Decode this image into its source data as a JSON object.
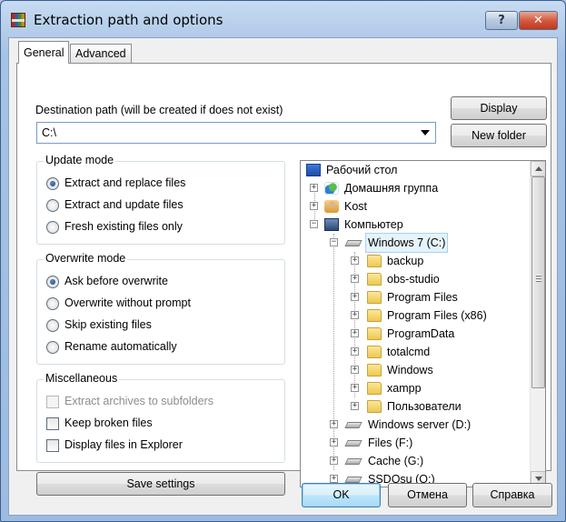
{
  "window": {
    "title": "Extraction path and options",
    "help_label": "?",
    "close_label": "✕"
  },
  "tabs": [
    {
      "label": "General"
    },
    {
      "label": "Advanced"
    }
  ],
  "destination": {
    "label": "Destination path (will be created if does not exist)",
    "value": "C:\\"
  },
  "buttons": {
    "display": "Display",
    "new_folder": "New folder",
    "save_settings": "Save settings",
    "ok": "OK",
    "cancel": "Отмена",
    "help": "Справка"
  },
  "update_mode": {
    "title": "Update mode",
    "options": [
      {
        "label": "Extract and replace files",
        "selected": true
      },
      {
        "label": "Extract and update files",
        "selected": false
      },
      {
        "label": "Fresh existing files only",
        "selected": false
      }
    ]
  },
  "overwrite_mode": {
    "title": "Overwrite mode",
    "options": [
      {
        "label": "Ask before overwrite",
        "selected": true
      },
      {
        "label": "Overwrite without prompt",
        "selected": false
      },
      {
        "label": "Skip existing files",
        "selected": false
      },
      {
        "label": "Rename automatically",
        "selected": false
      }
    ]
  },
  "misc": {
    "title": "Miscellaneous",
    "options": [
      {
        "label": "Extract archives to subfolders",
        "checked": false,
        "enabled": false
      },
      {
        "label": "Keep broken files",
        "checked": false,
        "enabled": true
      },
      {
        "label": "Display files in Explorer",
        "checked": false,
        "enabled": true
      }
    ]
  },
  "tree": {
    "items": [
      {
        "label": "Рабочий стол",
        "icon": "desktop-icon"
      },
      {
        "label": "Домашняя группа",
        "icon": "homegroup-icon"
      },
      {
        "label": "Kost",
        "icon": "user-folder-icon"
      },
      {
        "label": "Компьютер",
        "icon": "computer-icon"
      },
      {
        "label": "Windows 7 (C:)",
        "icon": "drive-icon",
        "selected": true
      },
      {
        "label": "backup",
        "icon": "folder-icon"
      },
      {
        "label": "obs-studio",
        "icon": "folder-icon"
      },
      {
        "label": "Program Files",
        "icon": "folder-icon"
      },
      {
        "label": "Program Files (x86)",
        "icon": "folder-icon"
      },
      {
        "label": "ProgramData",
        "icon": "folder-icon"
      },
      {
        "label": "totalcmd",
        "icon": "folder-icon"
      },
      {
        "label": "Windows",
        "icon": "folder-icon"
      },
      {
        "label": "xampp",
        "icon": "folder-icon"
      },
      {
        "label": "Пользователи",
        "icon": "folder-icon"
      },
      {
        "label": "Windows server (D:)",
        "icon": "drive-icon"
      },
      {
        "label": "Files (F:)",
        "icon": "drive-icon"
      },
      {
        "label": "Cache (G:)",
        "icon": "drive-icon"
      },
      {
        "label": "SSDOsu (O:)",
        "icon": "drive-icon"
      }
    ]
  }
}
